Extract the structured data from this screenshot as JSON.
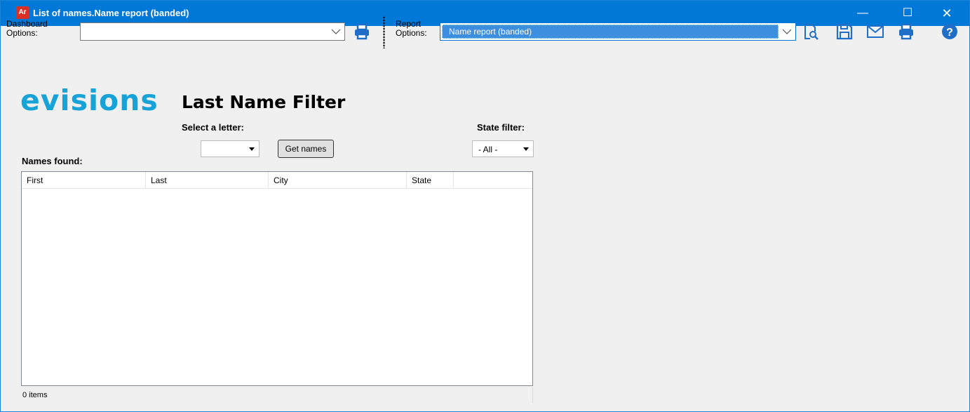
{
  "window": {
    "app_badge": "Ar",
    "title": "List of names.Name report (banded)",
    "controls": {
      "minimize": "—",
      "maximize": "☐",
      "close": "✕"
    }
  },
  "toolbar": {
    "dashboard_options_label_line1": "Dashboard",
    "dashboard_options_label_line2": "Options:",
    "dashboard_options_value": "",
    "report_options_label_line1": "Report",
    "report_options_label_line2": "Options:",
    "report_options_value": "Name report (banded)",
    "icons": [
      "print-icon",
      "preview-icon",
      "save-icon",
      "email-icon",
      "print-icon",
      "help-icon"
    ]
  },
  "content": {
    "logo": "evisions",
    "heading": "Last Name Filter",
    "select_letter_label": "Select a letter:",
    "letter_value": "",
    "get_names_button": "Get names",
    "state_filter_label": "State filter:",
    "state_value": "- All -",
    "names_found_label": "Names found:",
    "columns": [
      "First",
      "Last",
      "City",
      "State"
    ],
    "rows": [],
    "status": "0 items"
  },
  "colors": {
    "titlebar": "#0078d7",
    "accent_icon": "#1f6ec7",
    "logo": "#17a3d8",
    "selection": "#3e8ee0"
  }
}
